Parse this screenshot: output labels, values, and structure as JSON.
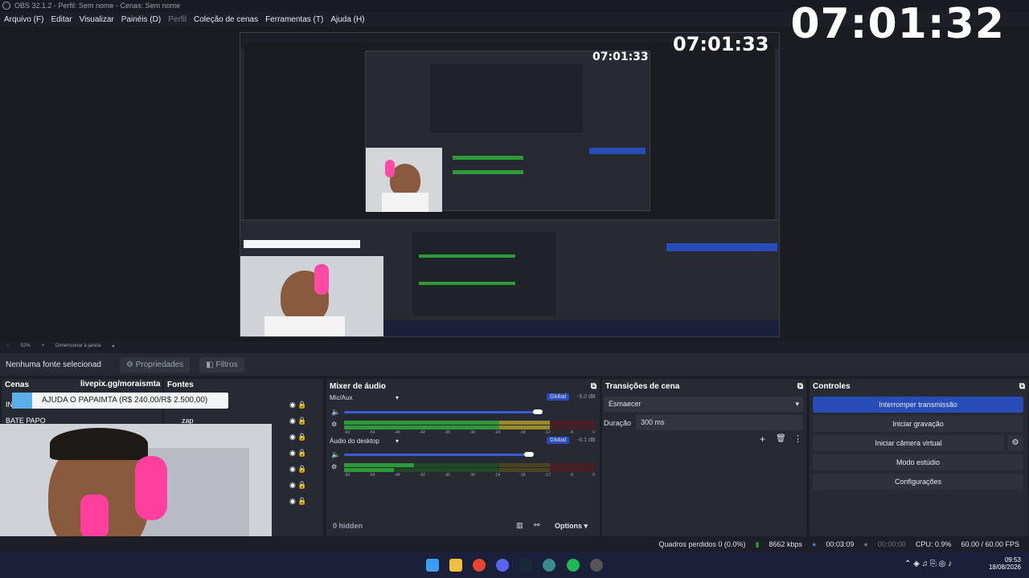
{
  "window": {
    "title": "OBS 32.1.2 - Perfil: Sem nome - Cenas: Sem nome"
  },
  "menu": [
    "Arquivo (F)",
    "Editar",
    "Visualizar",
    "Painéis (D)",
    "Perfil",
    "Coleção de cenas",
    "Ferramentas (T)",
    "Ajuda (H)"
  ],
  "overlay": {
    "clock": "07:01:32",
    "nested_clock": "07:01:33",
    "nested_clock2": "07:01:33",
    "livepix": "livepix.gg/moraismta",
    "banner": "AJUDA O PAPAIMTA (R$ 240,00/R$ 2.500,00)"
  },
  "zoom": {
    "value": "52%",
    "mode": "Dimensionar à janela"
  },
  "source_bar": {
    "selected": "Nenhuma fonte selecionad",
    "properties": "Propriedades",
    "filters": "Filtros"
  },
  "scenes": {
    "title": "Cenas",
    "items": [
      "IN",
      "BATE PAPO"
    ]
  },
  "sources": {
    "title": "Fontes",
    "items": [
      "zap"
    ]
  },
  "mixer": {
    "title": "Mixer de áudio",
    "channels": [
      {
        "name": "Mic/Aux",
        "scope": "Global",
        "db": "-5.0 dB",
        "level": 0.68
      },
      {
        "name": "Áudio do desktop",
        "scope": "Global",
        "db": "-6.1 dB",
        "level": 0.65
      }
    ],
    "ticks": [
      "-60",
      "-54",
      "-48",
      "-42",
      "-36",
      "-30",
      "-24",
      "-18",
      "-12",
      "-6",
      "0"
    ],
    "hidden": "0 hidden",
    "options": "Options"
  },
  "transitions": {
    "title": "Transições de cena",
    "selected": "Esmaecer",
    "duration_label": "Duração",
    "duration": "300 ms"
  },
  "controls": {
    "title": "Controles",
    "buttons": [
      "Interromper transmissão",
      "Iniciar gravação",
      "Iniciar câmera virtual",
      "Modo estúdio",
      "Configurações"
    ]
  },
  "status": {
    "dropped": "Quadros perdidos 0 (0.0%)",
    "bitrate": "8662 kbps",
    "stream_time": "00:03:09",
    "rec_time": "00:00:00",
    "cpu": "CPU: 0.9%",
    "fps": "60.00 / 60.00 FPS"
  },
  "taskbar": {
    "time": "09:53",
    "date": "18/08/2026"
  },
  "colors": {
    "accent": "#284cb8",
    "bg": "#1e1f26",
    "panel": "#272a33"
  }
}
